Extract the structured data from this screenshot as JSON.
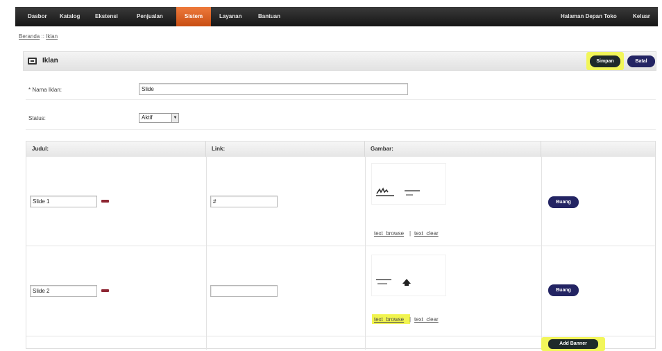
{
  "nav": {
    "items": [
      {
        "label": "Dasbor"
      },
      {
        "label": "Katalog"
      },
      {
        "label": "Ekstensi"
      },
      {
        "label": "Penjualan"
      },
      {
        "label": "Sistem",
        "active": true
      },
      {
        "label": "Layanan"
      },
      {
        "label": "Bantuan"
      }
    ],
    "right": [
      {
        "label": "Halaman Depan Toko"
      },
      {
        "label": "Keluar"
      }
    ],
    "active_color": "#e0642a"
  },
  "breadcrumb": {
    "items": [
      "Beranda",
      "Iklan"
    ],
    "separator": "::"
  },
  "heading": {
    "icon": "banner-icon",
    "title": "Iklan",
    "save_label": "Simpan",
    "cancel_label": "Batal"
  },
  "form": {
    "name_label": "* Nama Iklan:",
    "name_value": "Slide",
    "status_label": "Status:",
    "status_value": "Aktif"
  },
  "table": {
    "columns": [
      "Judul:",
      "Link:",
      "Gambar:",
      ""
    ],
    "rows": [
      {
        "title_value": "Slide 1",
        "link_value": "#",
        "image_alt": "banner-thumbnail-1",
        "browse_label": "text_browse",
        "clear_label": "text_clear",
        "remove_label": "Buang"
      },
      {
        "title_value": "Slide 2",
        "link_value": "",
        "image_alt": "banner-thumbnail-2",
        "browse_label": "text_browse",
        "clear_label": "text_clear",
        "remove_label": "Buang"
      }
    ],
    "add_label": "Add Banner"
  },
  "colors": {
    "highlight": "#f2f65a",
    "navy_button": "#232463",
    "dark_button": "#1f2a2a",
    "flag": "#8e2633"
  }
}
